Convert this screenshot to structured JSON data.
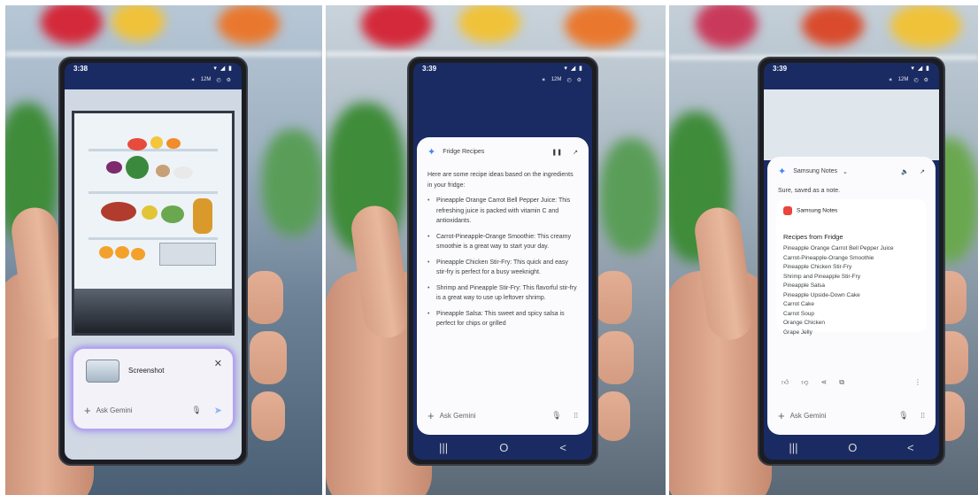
{
  "panel1": {
    "status_time": "3:38",
    "status_icons": "▾ ◢ ▮",
    "camera_row": [
      "✶",
      "12M",
      "◴",
      "⚙"
    ],
    "screenshot_label": "Screenshot",
    "close_icon": "close-icon",
    "ask_placeholder": "Ask Gemini",
    "nav": [
      "|||",
      "O",
      "<"
    ]
  },
  "panel2": {
    "status_time": "3:39",
    "status_icons": "▾ ◢ ▮",
    "camera_row": [
      "✶",
      "12M",
      "◴",
      "⚙"
    ],
    "header_title": "Fridge Recipes",
    "intro": "Here are some recipe ideas based on the ingredients in your fridge:",
    "recipes": [
      "Pineapple Orange Carrot Bell Pepper Juice: This refreshing juice is packed with vitamin C and antioxidants.",
      "Carrot-Pineapple-Orange Smoothie: This creamy smoothie is a great way to start your day.",
      "Pineapple Chicken Stir-Fry: This quick and easy stir-fry is perfect for a busy weeknight.",
      "Shrimp and Pineapple Stir-Fry: This flavorful stir-fry is a great way to use up leftover shrimp.",
      "Pineapple Salsa: This sweet and spicy salsa is perfect for chips or grilled"
    ],
    "ask_placeholder": "Ask Gemini",
    "nav": [
      "|||",
      "O",
      "<"
    ]
  },
  "panel3": {
    "status_time": "3:39",
    "status_icons": "▾ ◢ ▮",
    "camera_row": [
      "✶",
      "12M",
      "◴",
      "⚙"
    ],
    "header_title": "Samsung Notes",
    "reply": "Sure, saved as a note.",
    "app_name": "Samsung Notes",
    "note_title": "Recipes from Fridge",
    "note_items": [
      "Pineapple Orange Carrot Bell Pepper Juice",
      "Carrot-Pineapple-Orange Smoothie",
      "Pineapple Chicken Stir-Fry",
      "Shrimp and Pineapple Stir-Fry",
      "Pineapple Salsa",
      "Pineapple Upside-Down Cake",
      "Carrot Cake",
      "Carrot Soup",
      "Orange Chicken",
      "Grape Jelly"
    ],
    "ask_placeholder": "Ask Gemini",
    "nav": [
      "|||",
      "O",
      "<"
    ]
  },
  "colors": {
    "gemini_blue": "#4285f4",
    "overlay_glow": "#8e7cf0",
    "notes_red": "#e8453c"
  }
}
